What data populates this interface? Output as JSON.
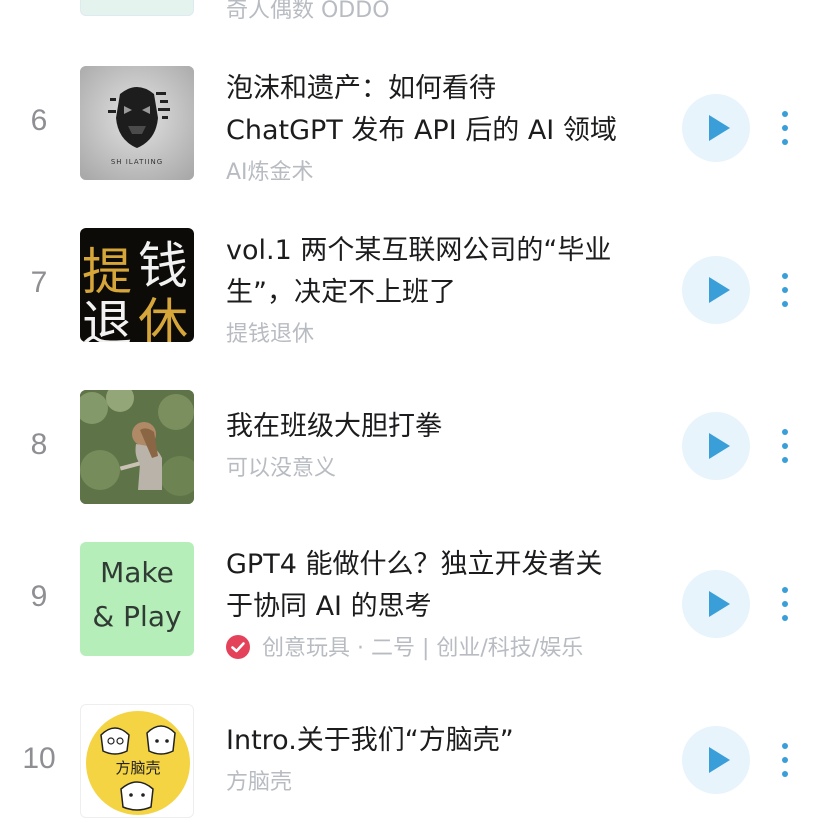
{
  "top_partial": {
    "author": "奇人偶数 ODDO"
  },
  "rows": [
    {
      "rank": "6",
      "title_lines": [
        "泡沫和遗产：如何看待",
        "ChatGPT 发布 API 后的 AI 领域"
      ],
      "author": "AI炼金术",
      "cover_icon": "ai-mask-cover",
      "cover_text": "SH ILATIING"
    },
    {
      "rank": "7",
      "title_lines": [
        "vol.1 两个某互联网公司的“毕业",
        "生”，决定不上班了"
      ],
      "author": "提钱退休",
      "cover_icon": "calligraphy-cover",
      "cover_chars": [
        "提",
        "钱",
        "退",
        "休"
      ]
    },
    {
      "rank": "8",
      "title_lines": [
        "我在班级大胆打拳"
      ],
      "author": "可以没意义",
      "cover_icon": "girl-photo-cover"
    },
    {
      "rank": "9",
      "title_lines": [
        "GPT4 能做什么？独立开发者关",
        "于协同 AI 的思考"
      ],
      "author": "创意玩具 · 二号 | 创业/科技/娱乐",
      "verified": true,
      "cover_icon": "make-play-cover",
      "cover_lines": [
        "Make",
        "& Play"
      ]
    },
    {
      "rank": "10",
      "title_lines": [
        "Intro.关于我们“方脑壳”"
      ],
      "author": "方脑壳",
      "cover_icon": "fangnaoke-cover",
      "cover_text": "方脑壳"
    }
  ],
  "icons": {
    "play": "play-icon",
    "more": "more-vertical-icon",
    "verified": "verified-check-icon"
  },
  "colors": {
    "play_accent": "#3a9ed8",
    "play_bg": "#e8f4fb",
    "verified_red": "#e3425a",
    "make_play_bg": "#b6eeb9",
    "fangnaoke_bg": "#f5d443"
  }
}
